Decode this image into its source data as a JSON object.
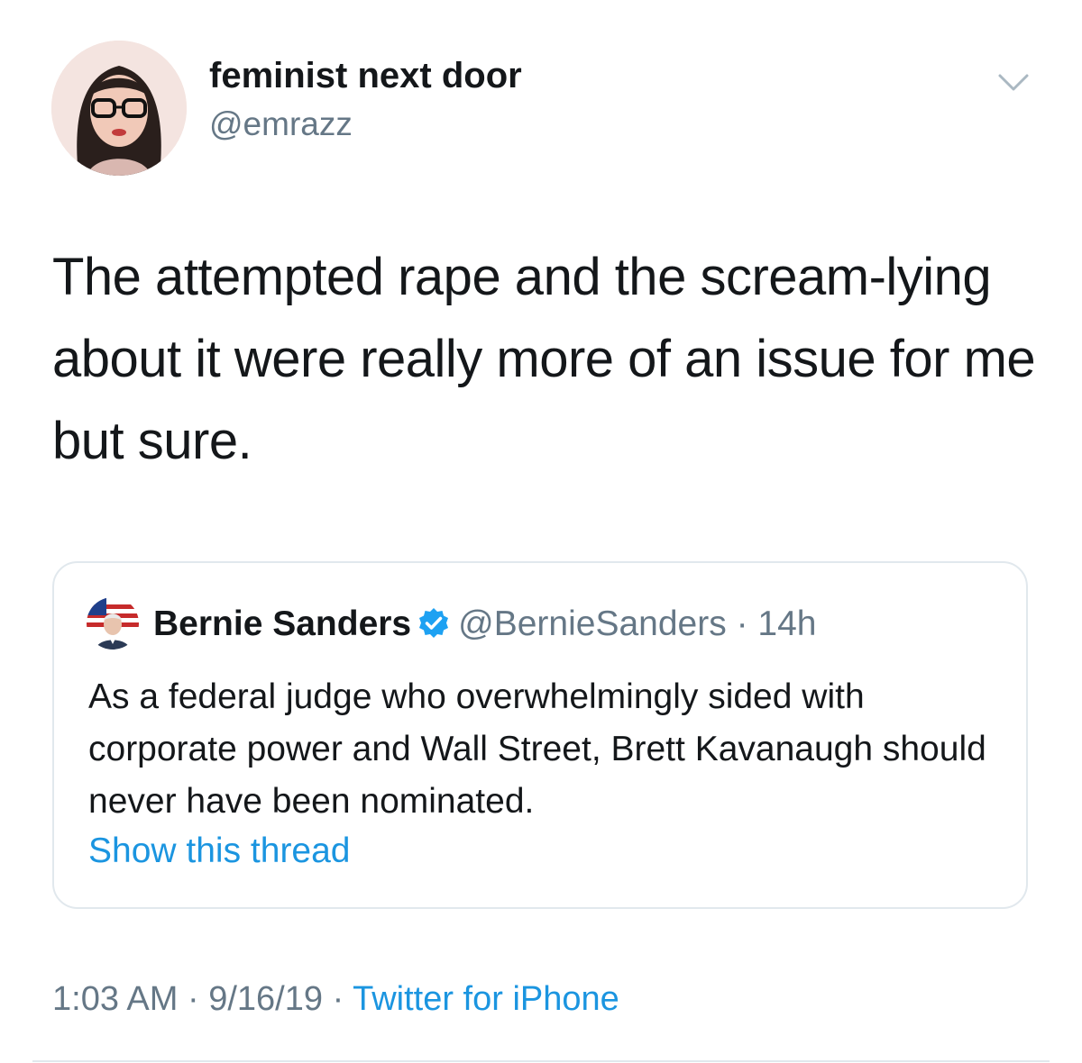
{
  "author": {
    "name": "feminist next door",
    "handle": "@emrazz"
  },
  "tweet": {
    "text": "The attempted rape and the scream-lying about it were really more of an issue for me but sure."
  },
  "quoted_tweet": {
    "name": "Bernie Sanders",
    "handle": "@BernieSanders",
    "separator": "·",
    "time": "14h",
    "text": "As a federal judge who overwhelmingly sided with corporate power and Wall Street, Brett Kavanaugh should never have been nominated.",
    "show_thread": "Show this thread"
  },
  "meta": {
    "time": "1:03 AM",
    "sep1": "·",
    "date": "9/16/19",
    "sep2": "·",
    "source": "Twitter for iPhone"
  },
  "icons": {
    "caret": "chevron-down-icon",
    "verified": "verified-badge-icon"
  },
  "colors": {
    "link": "#1b95e0",
    "secondary_text": "#657786",
    "border": "#e1e8ed",
    "verified": "#1da1f2"
  }
}
